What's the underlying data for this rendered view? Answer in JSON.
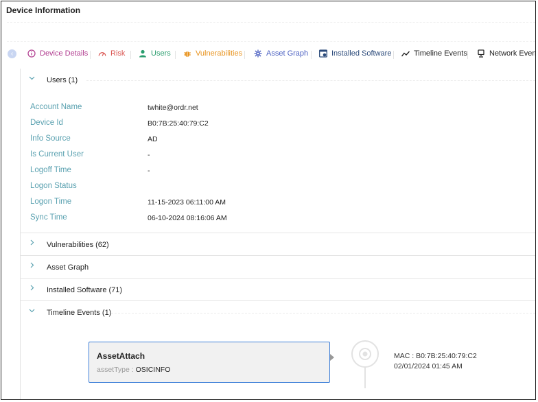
{
  "window": {
    "title": "Device Information"
  },
  "tabs": [
    {
      "label": "Device Details",
      "icon": "info-circle-icon",
      "color": "#b03a8e"
    },
    {
      "label": "Risk",
      "icon": "gauge-icon",
      "color": "#d9534f"
    },
    {
      "label": "Users",
      "icon": "user-icon",
      "color": "#2a9d6e"
    },
    {
      "label": "Vulnerabilities",
      "icon": "bug-icon",
      "color": "#e8931e"
    },
    {
      "label": "Asset Graph",
      "icon": "asterisk-icon",
      "color": "#4a5fc1"
    },
    {
      "label": "Installed Software",
      "icon": "window-gear-icon",
      "color": "#2b4a7a"
    },
    {
      "label": "Timeline Events",
      "icon": "trend-line-icon",
      "color": "#222222"
    },
    {
      "label": "Network Events",
      "icon": "monitor-icon",
      "color": "#222222"
    }
  ],
  "sections": {
    "users": {
      "label": "Users (1)"
    },
    "vulnerabilities": {
      "label": "Vulnerabilities (62)"
    },
    "asset_graph": {
      "label": "Asset Graph"
    },
    "installed_software": {
      "label": "Installed Software (71)"
    },
    "timeline_events": {
      "label": "Timeline Events (1)"
    }
  },
  "user_details": [
    {
      "label": "Account Name",
      "value": "twhite@ordr.net"
    },
    {
      "label": "Device Id",
      "value": "B0:7B:25:40:79:C2"
    },
    {
      "label": "Info Source",
      "value": "AD"
    },
    {
      "label": "Is Current User",
      "value": "-"
    },
    {
      "label": "Logoff Time",
      "value": "-"
    },
    {
      "label": "Logon Status",
      "value": ""
    },
    {
      "label": "Logon Time",
      "value": "11-15-2023 06:11:00 AM"
    },
    {
      "label": "Sync Time",
      "value": "06-10-2024 08:16:06 AM"
    }
  ],
  "timeline_event": {
    "title": "AssetAttach",
    "sub_key": "assetType :",
    "sub_value": "OSICINFO",
    "mac": "MAC : B0:7B:25:40:79:C2",
    "time": "02/01/2024 01:45 AM"
  },
  "colors": {
    "label_teal": "#5aa1b0",
    "card_border": "#3e7fd8",
    "back_button": "#c9d6f2"
  }
}
